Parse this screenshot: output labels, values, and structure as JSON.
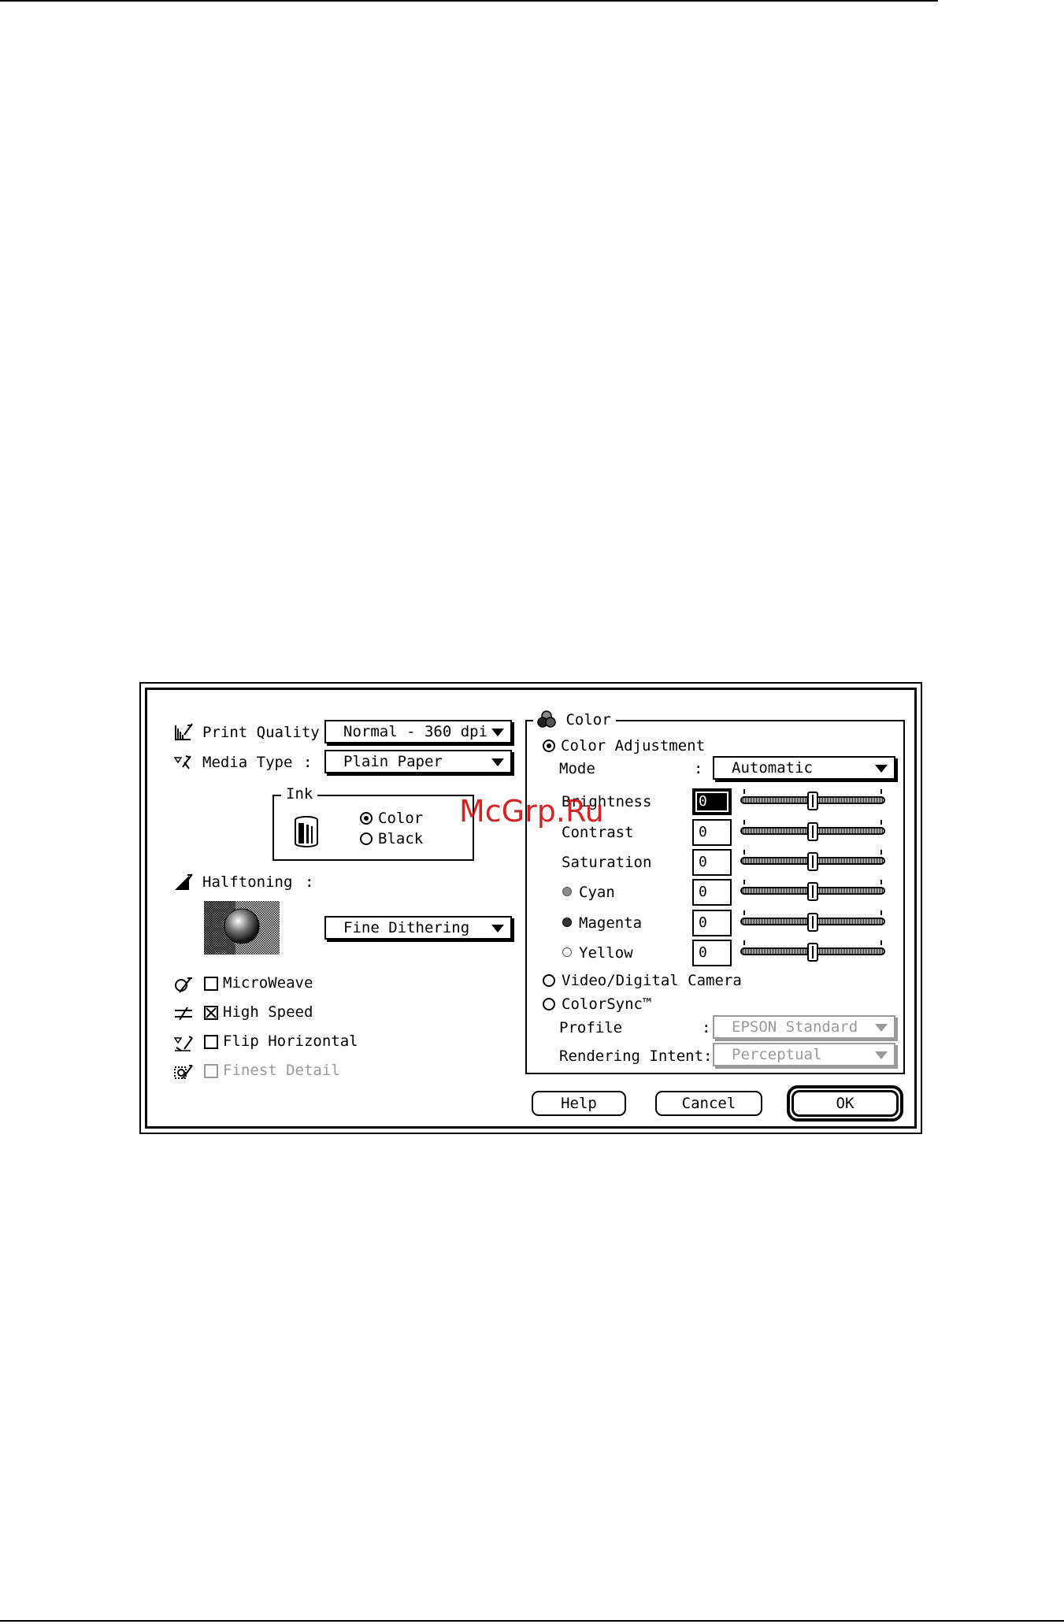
{
  "watermark": "McGrp.Ru",
  "dialog": {
    "print_quality": {
      "label": "Print Quality :",
      "value": "Normal - 360 dpi"
    },
    "media_type": {
      "label": "Media Type",
      "colon": ":",
      "value": "Plain Paper"
    },
    "ink": {
      "title": "Ink",
      "options": [
        "Color",
        "Black"
      ],
      "selected": "Color"
    },
    "halftoning": {
      "label": "Halftoning",
      "colon": ":",
      "value": "Fine Dithering"
    },
    "options": [
      {
        "label": "MicroWeave",
        "checked": false,
        "enabled": true
      },
      {
        "label": "High Speed",
        "checked": true,
        "enabled": true
      },
      {
        "label": "Flip Horizontal",
        "checked": false,
        "enabled": true
      },
      {
        "label": "Finest Detail",
        "checked": false,
        "enabled": false
      }
    ],
    "color": {
      "title": "Color",
      "color_adjustment": "Color Adjustment",
      "mode_label": "Mode",
      "mode_colon": ":",
      "mode_value": "Automatic",
      "adjustments": [
        {
          "label": "Brightness",
          "value": "0",
          "dot": ""
        },
        {
          "label": "Contrast",
          "value": "0",
          "dot": ""
        },
        {
          "label": "Saturation",
          "value": "0",
          "dot": ""
        },
        {
          "label": "Cyan",
          "value": "0",
          "dot": "#8a8a8a"
        },
        {
          "label": "Magenta",
          "value": "0",
          "dot": "#333333"
        },
        {
          "label": "Yellow",
          "value": "0",
          "dot": "#ffffff"
        }
      ],
      "video_camera": "Video/Digital Camera",
      "colorsync": "ColorSync™",
      "profile_label": "Profile",
      "profile_colon": ":",
      "profile_value": "EPSON Standard",
      "intent_label": "Rendering Intent:",
      "intent_value": "Perceptual",
      "selected": "Color Adjustment"
    },
    "buttons": {
      "help": "Help",
      "cancel": "Cancel",
      "ok": "OK"
    }
  }
}
